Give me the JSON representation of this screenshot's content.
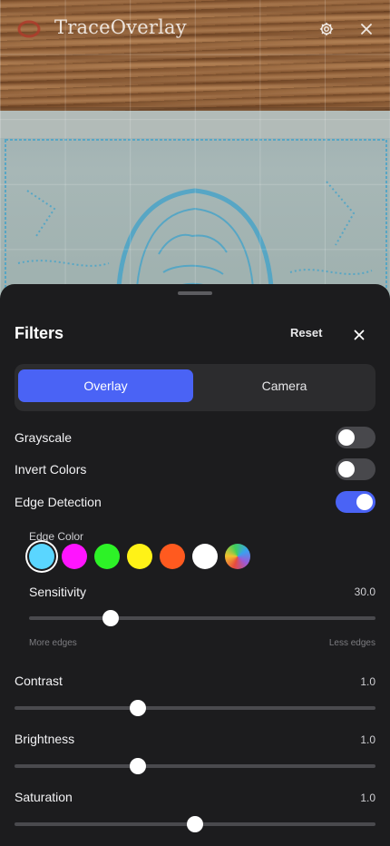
{
  "app": {
    "title": "TraceOverlay",
    "icons": {
      "logo": "trace-logo-icon",
      "settings": "gear-icon",
      "close": "close-icon"
    }
  },
  "sheet": {
    "title": "Filters",
    "reset_label": "Reset",
    "tabs": [
      {
        "label": "Overlay",
        "active": true
      },
      {
        "label": "Camera",
        "active": false
      }
    ],
    "toggles": [
      {
        "label": "Grayscale",
        "on": false
      },
      {
        "label": "Invert Colors",
        "on": false
      },
      {
        "label": "Edge Detection",
        "on": true
      }
    ],
    "edge_color": {
      "label": "Edge Color",
      "colors": [
        "#5ad6ff",
        "#ff14ff",
        "#2df227",
        "#fff217",
        "#ff5a1f",
        "#ffffff",
        "gradient"
      ],
      "selected": 0
    },
    "sensitivity": {
      "label": "Sensitivity",
      "value_text": "30.0",
      "fraction": 0.236,
      "hint_left": "More edges",
      "hint_right": "Less edges"
    },
    "sliders": [
      {
        "label": "Contrast",
        "value_text": "1.0",
        "fraction": 0.342
      },
      {
        "label": "Brightness",
        "value_text": "1.0",
        "fraction": 0.342
      },
      {
        "label": "Saturation",
        "value_text": "1.0",
        "fraction": 0.5
      }
    ],
    "accent_color": "#4a63f5"
  }
}
